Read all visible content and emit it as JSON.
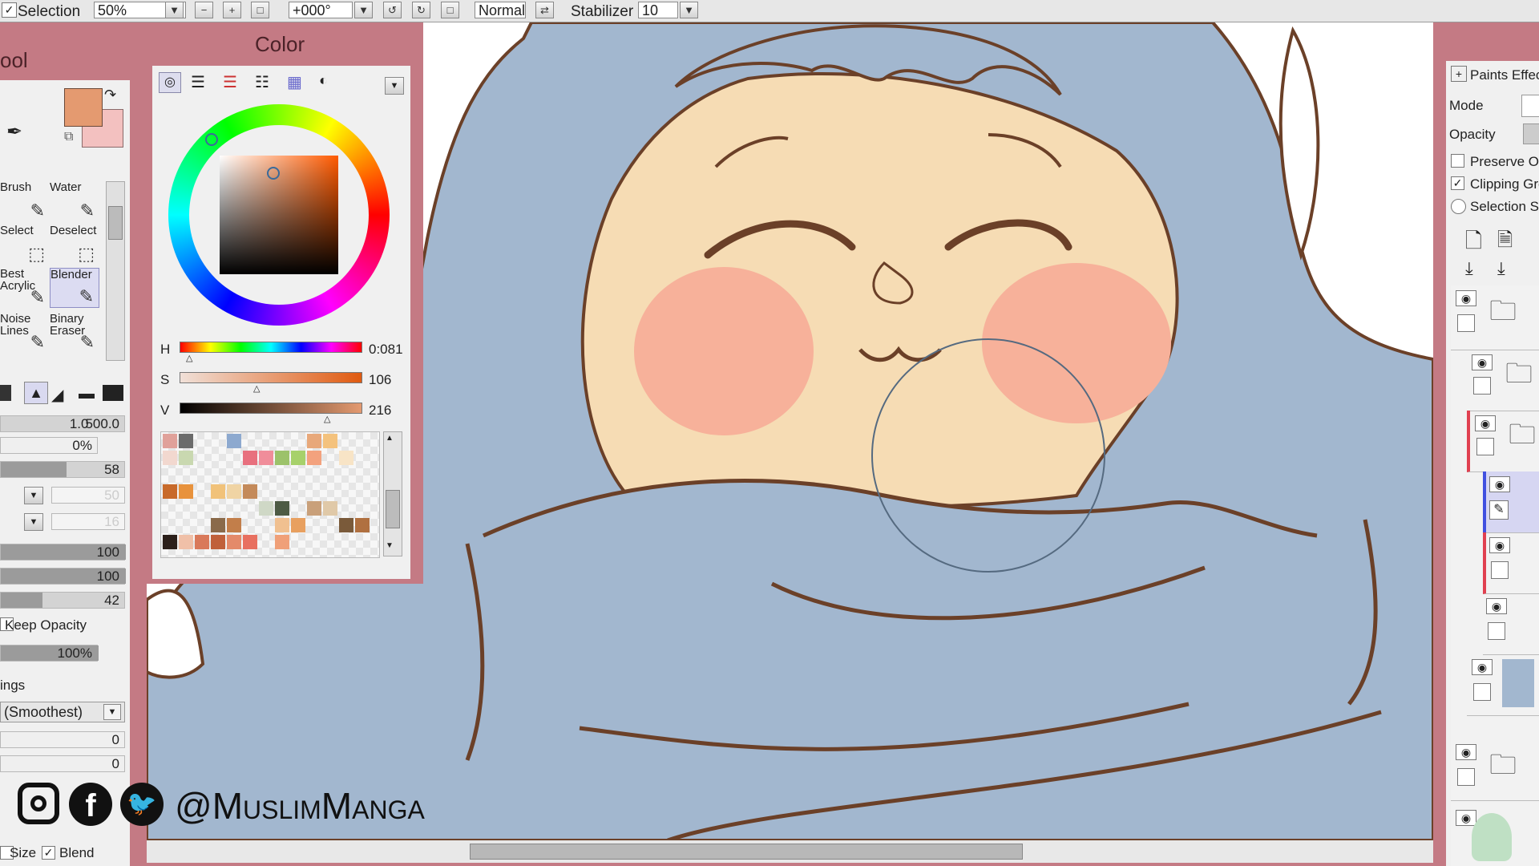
{
  "toolbar": {
    "selection_label": "Selection",
    "zoom_value": "50%",
    "rotation_value": "+000°",
    "blend_mode": "Normal",
    "stabilizer_label": "Stabilizer",
    "stabilizer_value": "10"
  },
  "tool_panel": {
    "title": "Tool",
    "tools": [
      {
        "label": "Brush"
      },
      {
        "label": "Water"
      },
      {
        "label": "Select"
      },
      {
        "label": "Deselect"
      },
      {
        "label": "Best Acrylic"
      },
      {
        "label": "Blender"
      },
      {
        "label": "Noise Lines"
      },
      {
        "label": "Binary Eraser"
      }
    ],
    "size_range": [
      "1.0",
      "500.0"
    ],
    "min_size": "0%",
    "density": "58",
    "blending_values": [
      "100",
      "100",
      "42"
    ],
    "disabled_values": [
      "50",
      "16"
    ],
    "keep_opacity_label": "Keep Opacity",
    "keep_opacity_value": "100%",
    "settings_label": "ings",
    "quality_value": "(Smoothest)",
    "edge_values": [
      "0",
      "0"
    ],
    "size_check_label": "Size",
    "blend_check_label": "Blend"
  },
  "color_panel": {
    "title": "Color",
    "h_label": "H",
    "h_value": "0:081",
    "s_label": "S",
    "s_value": "106",
    "v_label": "V",
    "v_value": "216",
    "primary_color": "#e49a70",
    "secondary_color": "#f3c1c0",
    "swatches": [
      "#e0a19a",
      "#6b6b6b",
      "#8da9cf",
      "#e8a87a",
      "#f4c27d",
      "#f2d8cf",
      "#c9d8b0",
      "#e8707e",
      "#f08d9a",
      "#9cc26a",
      "#a7d16b",
      "#f3a27e",
      "#f8e4c6",
      "#c86a2a",
      "#e8923c",
      "#f1c27a",
      "#f0d4a4",
      "#c48a5a",
      "#cfd8c6",
      "#4d5b44",
      "#c9a07a",
      "#e0c9a8",
      "#8a6a4a",
      "#c27e4a",
      "#f0c090",
      "#e8a060",
      "#7a5a3a",
      "#b07040",
      "#2b1f1a",
      "#f0c0a8",
      "#d9795a",
      "#c0603a",
      "#e48a6a",
      "#e87060",
      "#f0a078"
    ]
  },
  "layers_panel": {
    "title": "Paints Effect",
    "mode_label": "Mode",
    "opacity_label": "Opacity",
    "preserve_label": "Preserve Opacity",
    "clipping_label": "Clipping Group",
    "selection_label": "Selection Source"
  },
  "watermark": {
    "handle": "@MuslimManga"
  },
  "colors": {
    "panel_bg": "#c47a84",
    "canvas_bg": "#ffffff",
    "hijab": "#a2b7cf",
    "skin": "#f6dcb4",
    "blush": "#f7b19a",
    "lineart": "#6b4028"
  }
}
